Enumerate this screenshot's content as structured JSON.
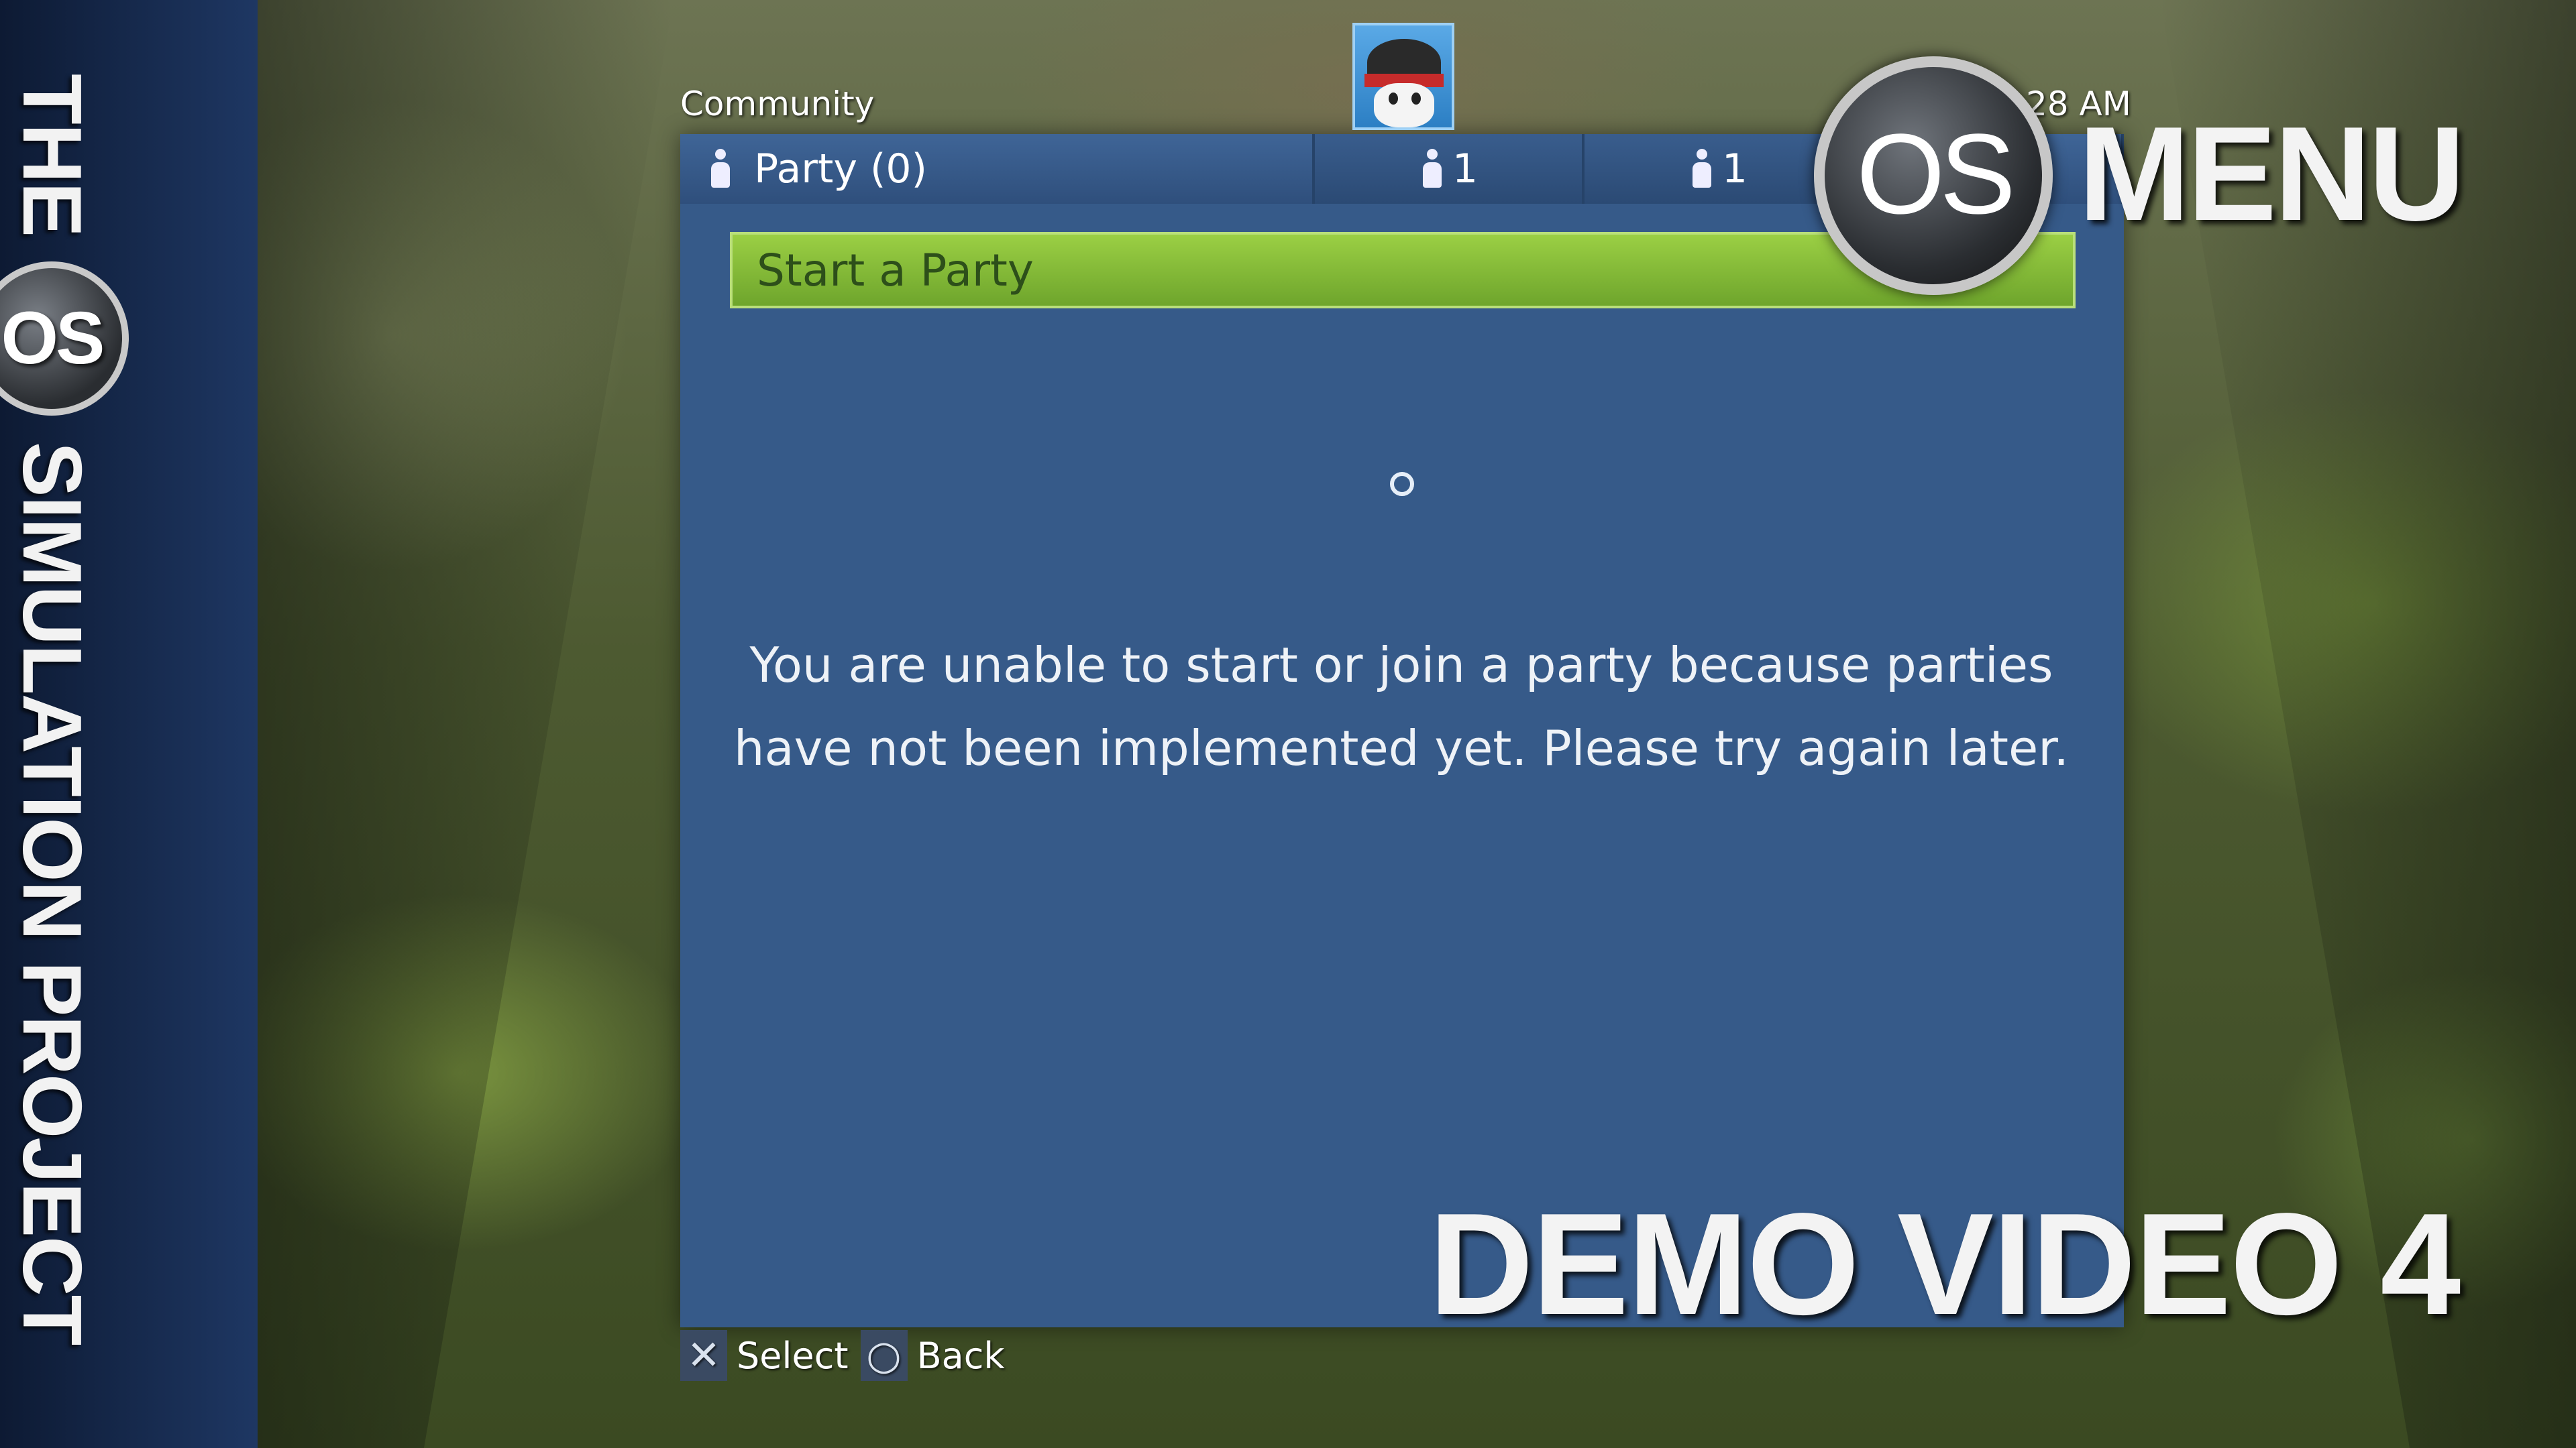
{
  "sidebar": {
    "title_pre": "THE",
    "logo": "OS",
    "title_post": "SIMULATION PROJECT"
  },
  "header": {
    "section": "Community",
    "clock": "28 AM"
  },
  "tabs": {
    "party_label": "Party (0)",
    "count_1": "1",
    "count_2": "1"
  },
  "main": {
    "start_party": "Start a Party",
    "message": "You are unable to start or join a party because parties have not been implemented yet. Please try again later."
  },
  "legend": {
    "select_glyph": "✕",
    "select_label": "Select",
    "back_glyph": "○",
    "back_label": "Back"
  },
  "overlay": {
    "logo": "OS",
    "menu": "MENU",
    "demo": "DEMO VIDEO 4"
  },
  "colors": {
    "panel": "#365a89",
    "button_green": "#8cc63f",
    "sidebar": "#1e3763"
  }
}
